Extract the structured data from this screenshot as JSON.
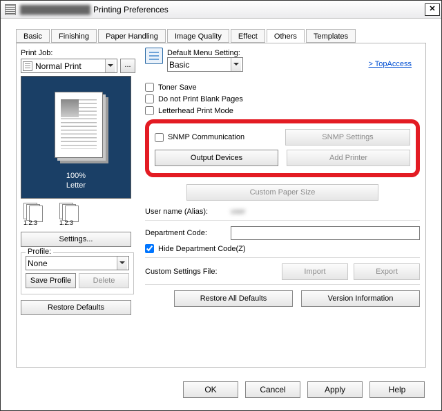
{
  "title": "Printing Preferences",
  "tabs": [
    {
      "label": "Basic"
    },
    {
      "label": "Finishing"
    },
    {
      "label": "Paper Handling"
    },
    {
      "label": "Image Quality"
    },
    {
      "label": "Effect"
    },
    {
      "label": "Others"
    },
    {
      "label": "Templates"
    }
  ],
  "active_tab": 5,
  "left": {
    "print_job_label": "Print Job:",
    "print_job_value": "Normal Print",
    "dots": "...",
    "preview_percent": "100%",
    "preview_media": "Letter",
    "stack_caption": "1.2.3",
    "settings_btn": "Settings...",
    "profile_label": "Profile:",
    "profile_value": "None",
    "save_profile": "Save Profile",
    "delete_profile": "Delete",
    "restore_defaults": "Restore Defaults"
  },
  "right": {
    "dms_label": "Default Menu Setting:",
    "dms_value": "Basic",
    "topaccess": ">  TopAccess",
    "ck_toner": "Toner Save",
    "ck_blank": "Do not Print Blank Pages",
    "ck_lhead": "Letterhead Print Mode",
    "ck_snmp": "SNMP Communication",
    "snmp_settings": "SNMP Settings",
    "output_devices": "Output Devices",
    "add_printer": "Add Printer",
    "custom_paper": "Custom Paper Size",
    "username_label": "User name (Alias):",
    "username_value": "user",
    "dept_label": "Department Code:",
    "dept_value": "",
    "hide_dept": "Hide Department Code(Z)",
    "csf_label": "Custom Settings File:",
    "import": "Import",
    "export": "Export",
    "restore_all": "Restore All Defaults",
    "version_info": "Version Information"
  },
  "dialog": {
    "ok": "OK",
    "cancel": "Cancel",
    "apply": "Apply",
    "help": "Help"
  }
}
